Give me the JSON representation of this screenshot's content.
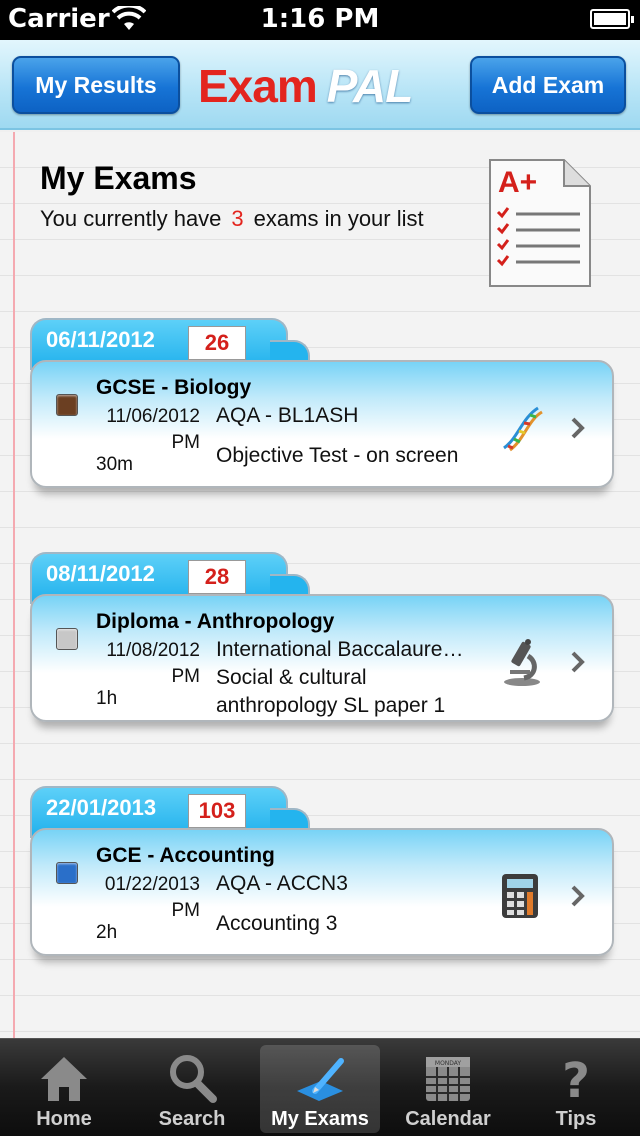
{
  "status_bar": {
    "carrier": "Carrier",
    "time": "1:16 PM"
  },
  "nav": {
    "left_button": "My Results",
    "logo_exam": "Exam",
    "logo_pal": "PAL",
    "right_button": "Add Exam"
  },
  "header": {
    "title": "My Exams",
    "subtitle_prefix": "You currently have",
    "exam_count": "3",
    "subtitle_suffix": "exams in your list",
    "badge_icon": "grade-a-plus-document-icon"
  },
  "exams": [
    {
      "tab_date": "06/11/2012",
      "days": "26",
      "color": "#6b3f22",
      "course": "GCSE - Biology",
      "date_line1": "11/06/2012",
      "date_line2": "PM",
      "duration": "30m",
      "info_lines": [
        "AQA - BL1ASH",
        "Objective Test - on screen"
      ],
      "icon": "dna-icon"
    },
    {
      "tab_date": "08/11/2012",
      "days": "28",
      "color": "#c7c7c7",
      "course": "Diploma - Anthropology",
      "date_line1": "11/08/2012",
      "date_line2": "PM",
      "duration": "1h",
      "info_lines": [
        "International Baccalaure…",
        "Social & cultural",
        "anthropology SL paper 1"
      ],
      "icon": "microscope-icon"
    },
    {
      "tab_date": "22/01/2013",
      "days": "103",
      "color": "#2a6fc9",
      "course": "GCE - Accounting",
      "date_line1": "01/22/2013",
      "date_line2": "PM",
      "duration": "2h",
      "info_lines": [
        "AQA - ACCN3",
        "Accounting 3"
      ],
      "icon": "calculator-icon"
    }
  ],
  "tabbar": {
    "items": [
      {
        "label": "Home",
        "icon": "house-icon"
      },
      {
        "label": "Search",
        "icon": "magnifier-icon"
      },
      {
        "label": "My Exams",
        "icon": "pencil-paper-icon",
        "active": true
      },
      {
        "label": "Calendar",
        "icon": "calendar-icon",
        "calendar_header": "MONDAY"
      },
      {
        "label": "Tips",
        "icon": "question-mark-icon"
      }
    ]
  }
}
